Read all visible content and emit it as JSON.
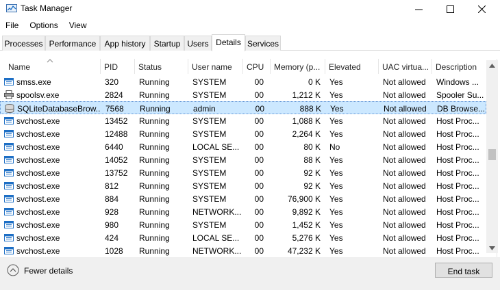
{
  "window": {
    "title": "Task Manager"
  },
  "menu": [
    "File",
    "Options",
    "View"
  ],
  "tabs": [
    "Processes",
    "Performance",
    "App history",
    "Startup",
    "Users",
    "Details",
    "Services"
  ],
  "active_tab": "Details",
  "columns": [
    "Name",
    "PID",
    "Status",
    "User name",
    "CPU",
    "Memory (p...",
    "Elevated",
    "UAC virtua...",
    "Description"
  ],
  "rows": [
    {
      "name": "smss.exe",
      "pid": "320",
      "status": "Running",
      "user": "SYSTEM",
      "cpu": "00",
      "memory": "0 K",
      "elevated": "Yes",
      "uac": "Not allowed",
      "desc": "Windows ...",
      "icon": "window-icon",
      "selected": false
    },
    {
      "name": "spoolsv.exe",
      "pid": "2824",
      "status": "Running",
      "user": "SYSTEM",
      "cpu": "00",
      "memory": "1,212 K",
      "elevated": "Yes",
      "uac": "Not allowed",
      "desc": "Spooler Su...",
      "icon": "printer-icon",
      "selected": false
    },
    {
      "name": "SQLiteDatabaseBrow...",
      "pid": "7568",
      "status": "Running",
      "user": "admin",
      "cpu": "00",
      "memory": "888 K",
      "elevated": "Yes",
      "uac": "Not allowed",
      "desc": "DB Browse...",
      "icon": "database-icon",
      "selected": true
    },
    {
      "name": "svchost.exe",
      "pid": "13452",
      "status": "Running",
      "user": "SYSTEM",
      "cpu": "00",
      "memory": "1,088 K",
      "elevated": "Yes",
      "uac": "Not allowed",
      "desc": "Host Proc...",
      "icon": "window-icon",
      "selected": false
    },
    {
      "name": "svchost.exe",
      "pid": "12488",
      "status": "Running",
      "user": "SYSTEM",
      "cpu": "00",
      "memory": "2,264 K",
      "elevated": "Yes",
      "uac": "Not allowed",
      "desc": "Host Proc...",
      "icon": "window-icon",
      "selected": false
    },
    {
      "name": "svchost.exe",
      "pid": "6440",
      "status": "Running",
      "user": "LOCAL SE...",
      "cpu": "00",
      "memory": "80 K",
      "elevated": "No",
      "uac": "Not allowed",
      "desc": "Host Proc...",
      "icon": "window-icon",
      "selected": false
    },
    {
      "name": "svchost.exe",
      "pid": "14052",
      "status": "Running",
      "user": "SYSTEM",
      "cpu": "00",
      "memory": "88 K",
      "elevated": "Yes",
      "uac": "Not allowed",
      "desc": "Host Proc...",
      "icon": "window-icon",
      "selected": false
    },
    {
      "name": "svchost.exe",
      "pid": "13752",
      "status": "Running",
      "user": "SYSTEM",
      "cpu": "00",
      "memory": "92 K",
      "elevated": "Yes",
      "uac": "Not allowed",
      "desc": "Host Proc...",
      "icon": "window-icon",
      "selected": false
    },
    {
      "name": "svchost.exe",
      "pid": "812",
      "status": "Running",
      "user": "SYSTEM",
      "cpu": "00",
      "memory": "92 K",
      "elevated": "Yes",
      "uac": "Not allowed",
      "desc": "Host Proc...",
      "icon": "window-icon",
      "selected": false
    },
    {
      "name": "svchost.exe",
      "pid": "884",
      "status": "Running",
      "user": "SYSTEM",
      "cpu": "00",
      "memory": "76,900 K",
      "elevated": "Yes",
      "uac": "Not allowed",
      "desc": "Host Proc...",
      "icon": "window-icon",
      "selected": false
    },
    {
      "name": "svchost.exe",
      "pid": "928",
      "status": "Running",
      "user": "NETWORK...",
      "cpu": "00",
      "memory": "9,892 K",
      "elevated": "Yes",
      "uac": "Not allowed",
      "desc": "Host Proc...",
      "icon": "window-icon",
      "selected": false
    },
    {
      "name": "svchost.exe",
      "pid": "980",
      "status": "Running",
      "user": "SYSTEM",
      "cpu": "00",
      "memory": "1,452 K",
      "elevated": "Yes",
      "uac": "Not allowed",
      "desc": "Host Proc...",
      "icon": "window-icon",
      "selected": false
    },
    {
      "name": "svchost.exe",
      "pid": "424",
      "status": "Running",
      "user": "LOCAL SE...",
      "cpu": "00",
      "memory": "5,276 K",
      "elevated": "Yes",
      "uac": "Not allowed",
      "desc": "Host Proc...",
      "icon": "window-icon",
      "selected": false
    },
    {
      "name": "svchost.exe",
      "pid": "1028",
      "status": "Running",
      "user": "NETWORK...",
      "cpu": "00",
      "memory": "47,232 K",
      "elevated": "Yes",
      "uac": "Not allowed",
      "desc": "Host Proc...",
      "icon": "window-icon",
      "selected": false
    }
  ],
  "footer": {
    "fewer_details": "Fewer details",
    "end_task": "End task"
  },
  "colors": {
    "selection": "#cce8ff",
    "footer_bg": "#f0f0f0",
    "icon_blue": "#1e6fc5"
  }
}
